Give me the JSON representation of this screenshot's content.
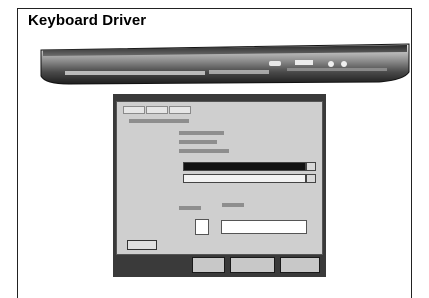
{
  "header": {
    "title": "Keyboard Driver"
  },
  "illustrations": {
    "keyboard": "keyboard-icon",
    "dialog": "driver-settings-dialog-image"
  },
  "colors": {
    "frame_border": "#222222",
    "dialog_frame": "#3a3a3a",
    "dialog_face": "#cfcfcf"
  }
}
